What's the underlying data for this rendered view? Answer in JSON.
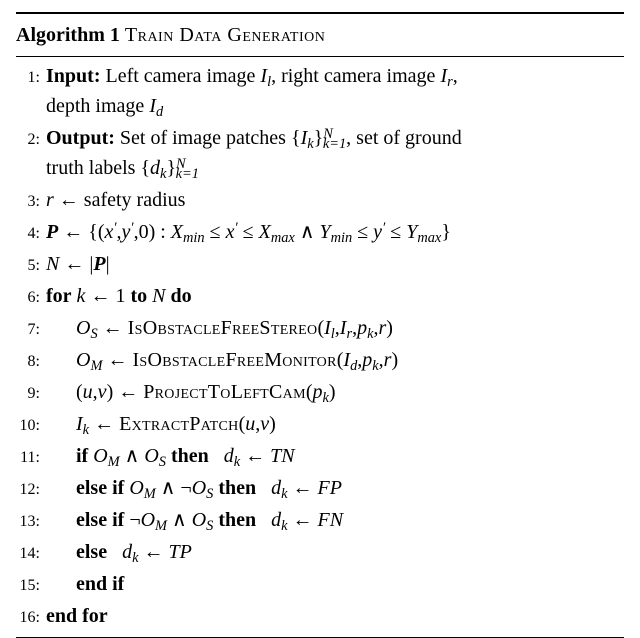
{
  "algo": {
    "number": "Algorithm 1",
    "title": "Train Data Generation",
    "lines": {
      "n1": "1:",
      "n2": "2:",
      "n3": "3:",
      "n4": "4:",
      "n5": "5:",
      "n6": "6:",
      "n7": "7:",
      "n8": "8:",
      "n9": "9:",
      "n10": "10:",
      "n11": "11:",
      "n12": "12:",
      "n13": "13:",
      "n14": "14:",
      "n15": "15:",
      "n16": "16:"
    },
    "kw": {
      "input": "Input:",
      "output": "Output:",
      "for": "for",
      "to": "to",
      "do": "do",
      "if": "if",
      "then": "then",
      "elseif": "else if",
      "else": "else",
      "endif": "end if",
      "endfor": "end for"
    },
    "text": {
      "left_camera": " Left camera image ",
      "right_camera": ", right camera image ",
      "depth_image": "depth image ",
      "set_patches": " Set of image patches ",
      "set_ground": ", set of ground",
      "truth_labels": "truth labels ",
      "safety_radius": " safety radius",
      "set_def_open": " {(",
      "cond_and": " ∧ ",
      "neg": "¬"
    },
    "sym": {
      "Il": "I",
      "Il_sub": "l",
      "Ir": "I",
      "Ir_sub": "r",
      "Id": "I",
      "Id_sub": "d",
      "Ik": "I",
      "Ik_sub": "k",
      "dk": "d",
      "dk_sub": "k",
      "k1": "k=1",
      "N_sup": "N",
      "r": "r",
      "P": "P",
      "N": "N",
      "k": "k",
      "one": "1",
      "xprime": "x",
      "xprime_sup": "′",
      "yprime": "y",
      "yprime_sup": "′",
      "zero": "0",
      "Xmin": "X",
      "Xmin_sub": "min",
      "Xmax": "X",
      "Xmax_sub": "max",
      "Ymin": "Y",
      "Ymin_sub": "min",
      "Ymax": "Y",
      "Ymax_sub": "max",
      "arrow": " ← ",
      "leq": " ≤ ",
      "OS": "O",
      "OS_sub": "S",
      "OM": "O",
      "OM_sub": "M",
      "pk": "p",
      "pk_sub": "k",
      "u": "u",
      "v": "v",
      "TN": "TN",
      "FP": "FP",
      "FN": "FN",
      "TP": "TP",
      "abs_l": "|",
      "abs_r": "|"
    },
    "fn": {
      "isobsstereo": "IsObstacleFreeStereo",
      "isobsmon": "IsObstacleFreeMonitor",
      "projleft": "ProjectToLeftCam",
      "extract": "ExtractPatch"
    }
  }
}
